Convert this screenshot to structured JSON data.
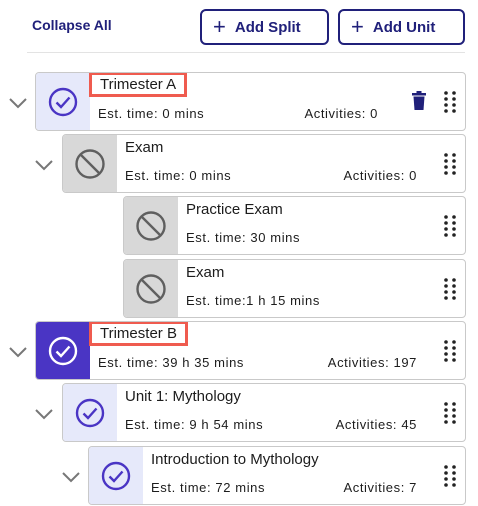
{
  "toolbar": {
    "collapse_all": "Collapse All",
    "add_split": "Add Split",
    "add_unit": "Add Unit"
  },
  "items": [
    {
      "title": "Trimester A",
      "est": "Est. time: 0 mins",
      "activities": "Activities: 0",
      "icon": "check-circle-icon",
      "badge": "light",
      "highlighted": true,
      "has_trash": true
    },
    {
      "title": "Exam",
      "est": "Est. time: 0 mins",
      "activities": "Activities: 0",
      "icon": "prohibited-icon",
      "badge": "gray"
    },
    {
      "title": "Practice Exam",
      "est": "Est. time: 30 mins",
      "activities": "",
      "icon": "prohibited-icon",
      "badge": "gray"
    },
    {
      "title": "Exam",
      "est": "Est. time:1 h 15 mins",
      "activities": "",
      "icon": "prohibited-icon",
      "badge": "gray"
    },
    {
      "title": "Trimester B",
      "est": "Est. time: 39 h 35 mins",
      "activities": "Activities: 197",
      "icon": "check-circle-icon",
      "badge": "dark",
      "highlighted": true
    },
    {
      "title": "Unit 1: Mythology",
      "est": "Est. time: 9 h 54 mins",
      "activities": "Activities: 45",
      "icon": "check-circle-icon",
      "badge": "light"
    },
    {
      "title": "Introduction to Mythology",
      "est": "Est. time: 72 mins",
      "activities": "Activities: 7",
      "icon": "check-circle-icon",
      "badge": "light"
    }
  ],
  "colors": {
    "accent": "#20207a",
    "primary": "#4a35c4",
    "highlight": "#ef5b4f"
  }
}
